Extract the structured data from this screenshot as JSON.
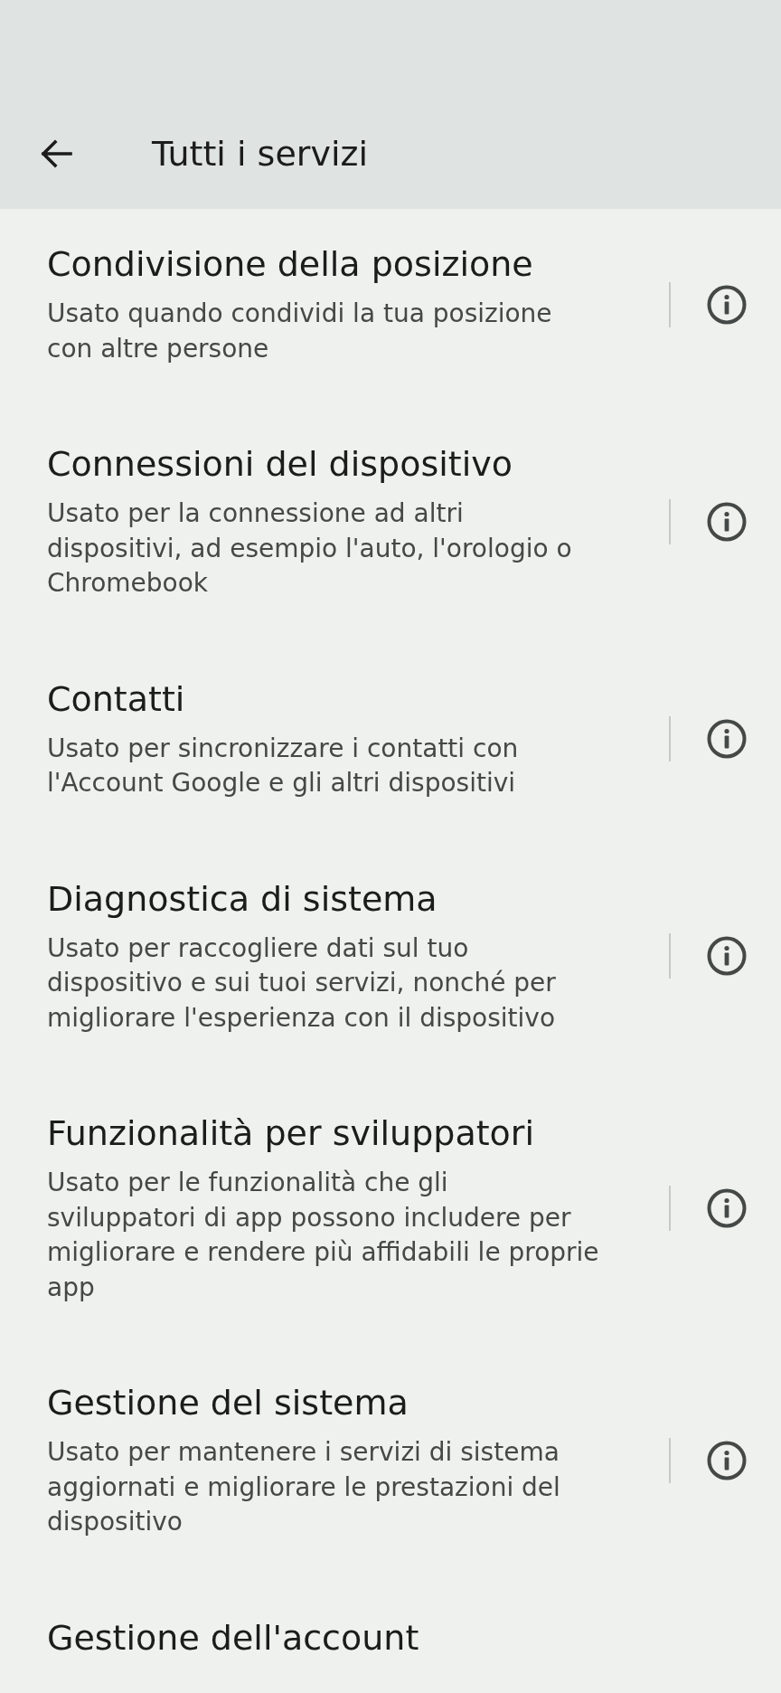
{
  "top_bar": {
    "title": "Tutti i servizi"
  },
  "services": [
    {
      "title": "Condivisione della posizione",
      "subtitle_lines": [
        "Usato quando condividi la tua posizione",
        "con altre persone"
      ],
      "info": true
    },
    {
      "title": "Connessioni del dispositivo",
      "subtitle_lines": [
        "Usato per la connessione ad altri",
        "dispositivi, ad esempio l'auto, l'orologio o",
        "Chromebook"
      ],
      "info": true
    },
    {
      "title": "Contatti",
      "subtitle_lines": [
        "Usato per sincronizzare i contatti con",
        "l'Account Google e gli altri dispositivi"
      ],
      "info": true
    },
    {
      "title": "Diagnostica di sistema",
      "subtitle_lines": [
        "Usato per raccogliere dati sul tuo",
        "dispositivo e sui tuoi servizi, nonché per",
        "migliorare l'esperienza con il dispositivo"
      ],
      "info": true
    },
    {
      "title": "Funzionalità per sviluppatori",
      "subtitle_lines": [
        "Usato per le funzionalità che gli",
        "sviluppatori di app possono includere per",
        "migliorare e rendere più affidabili le proprie",
        "app"
      ],
      "info": true
    },
    {
      "title": "Gestione del sistema",
      "subtitle_lines": [
        "Usato per mantenere i servizi di sistema",
        "aggiornati e migliorare le prestazioni del",
        "dispositivo"
      ],
      "info": true
    },
    {
      "title": "Gestione dell'account",
      "info": false
    }
  ]
}
